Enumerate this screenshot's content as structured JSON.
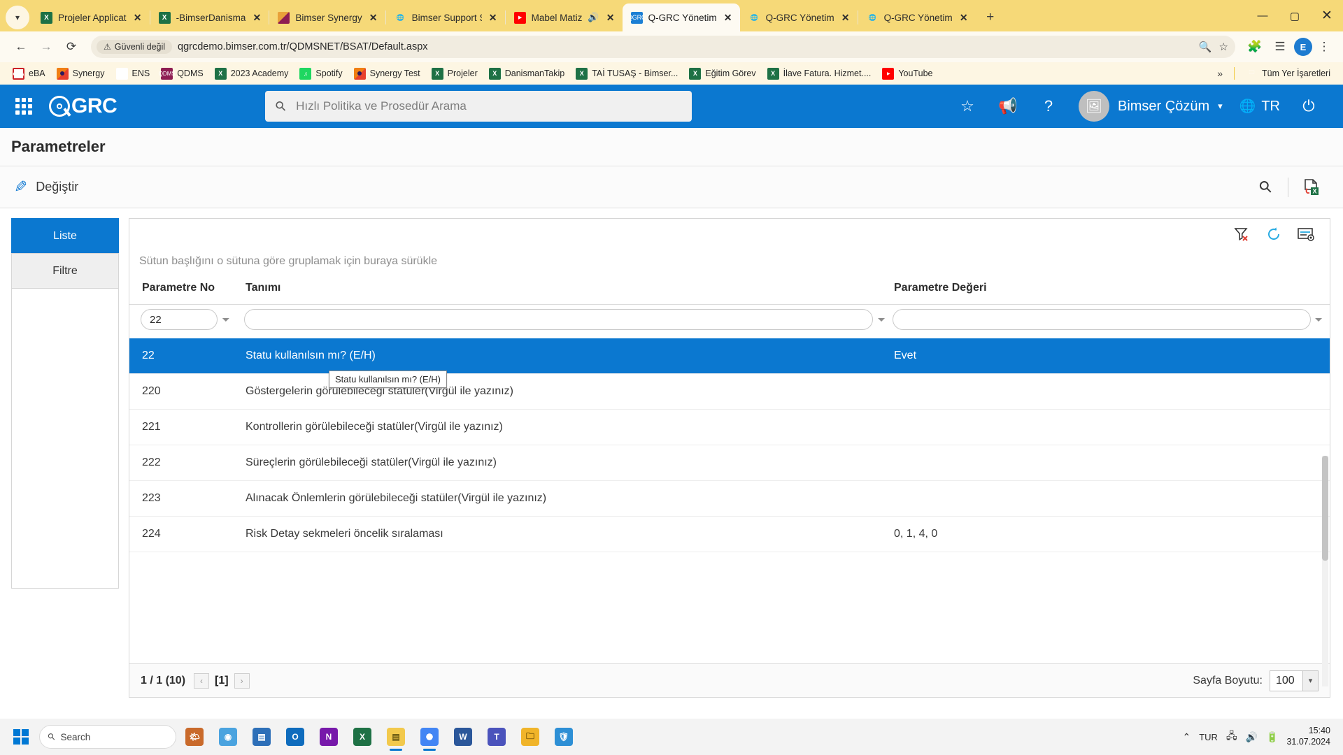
{
  "browser": {
    "tabs": [
      {
        "title": "Projeler Applicat",
        "favicon": "excel-icon",
        "active": false,
        "audio": false
      },
      {
        "title": "-BimserDanisma",
        "favicon": "excel-icon",
        "active": false,
        "audio": false
      },
      {
        "title": "Bimser Synergy",
        "favicon": "bimser-icon",
        "active": false,
        "audio": false
      },
      {
        "title": "Bimser Support S",
        "favicon": "globe-icon",
        "active": false,
        "audio": false
      },
      {
        "title": "Mabel Matiz",
        "favicon": "youtube-icon",
        "active": false,
        "audio": true
      },
      {
        "title": "Q-GRC Yönetim",
        "favicon": "qgrc-icon",
        "active": true,
        "audio": false
      },
      {
        "title": "Q-GRC Yönetim",
        "favicon": "globe-icon",
        "active": false,
        "audio": false
      },
      {
        "title": "Q-GRC Yönetim",
        "favicon": "globe-icon",
        "active": false,
        "audio": false
      }
    ],
    "new_tab_label": "+",
    "window_controls": {
      "minimize": "—",
      "maximize": "▢",
      "close": "✕"
    },
    "nav": {
      "back": "←",
      "forward": "→",
      "reload": "⟳"
    },
    "security_label": "Güvenli değil",
    "security_icon": "warning-triangle-icon",
    "url": "qgrcdemo.bimser.com.tr/QDMSNET/BSAT/Default.aspx",
    "omnibox_icons": {
      "zoom": "zoom-icon",
      "bookmark": "star-icon",
      "extensions": "puzzle-icon",
      "reading_list": "reading-list-icon"
    },
    "profile_initial": "E",
    "menu_icon": "kebab-menu-icon",
    "bookmarks": [
      {
        "label": "eBA",
        "icon": "eba-icon"
      },
      {
        "label": "Synergy",
        "icon": "synergy-icon"
      },
      {
        "label": "ENS",
        "icon": "ens-icon"
      },
      {
        "label": "QDMS",
        "icon": "qdms-icon"
      },
      {
        "label": "2023 Academy",
        "icon": "excel-icon"
      },
      {
        "label": "Spotify",
        "icon": "spotify-icon"
      },
      {
        "label": "Synergy Test",
        "icon": "synergy-icon"
      },
      {
        "label": "Projeler",
        "icon": "excel-icon"
      },
      {
        "label": "DanismanTakip",
        "icon": "excel-icon"
      },
      {
        "label": "TAİ TUSAŞ - Bimser...",
        "icon": "excel-icon"
      },
      {
        "label": "Eğitim Görev",
        "icon": "excel-icon"
      },
      {
        "label": "İlave Fatura. Hizmet....",
        "icon": "excel-icon"
      },
      {
        "label": "YouTube",
        "icon": "youtube-icon"
      }
    ],
    "bookmarks_overflow": "»",
    "all_bookmarks_label": "Tüm Yer İşaretleri",
    "all_bookmarks_icon": "folder-icon"
  },
  "app": {
    "brand": "GRC",
    "apps_grid_icon": "app-grid-icon",
    "search_placeholder": "Hızlı Politika ve Prosedür Arama",
    "search_icon": "search-icon",
    "header_icons": {
      "favorites": "star-icon",
      "announcements": "megaphone-icon",
      "help": "question-mark-icon",
      "power": "power-icon"
    },
    "user_name": "Bimser Çözüm",
    "user_avatar_icon": "avatar-image-icon",
    "user_chevron": "chevron-down-icon",
    "language": "TR",
    "language_icon": "translate-icon",
    "page_title": "Parametreler",
    "action_bar": {
      "edit_label": "Değiştir",
      "edit_icon": "pencil-icon",
      "search_icon": "search-icon",
      "export_excel_icon": "export-excel-icon"
    },
    "side_tabs": [
      {
        "label": "Liste",
        "active": true
      },
      {
        "label": "Filtre",
        "active": false
      }
    ],
    "grid": {
      "tools": {
        "clear_filter_icon": "filter-clear-icon",
        "refresh_icon": "refresh-icon",
        "column_chooser_icon": "column-settings-icon"
      },
      "group_hint": "Sütun başlığını o sütuna göre gruplamak için buraya sürükle",
      "columns": [
        "Parametre No",
        "Tanımı",
        "Parametre Değeri"
      ],
      "filters": {
        "parametre_no": "22",
        "tanimi": "",
        "parametre_degeri": ""
      },
      "filter_icon": "filter-funnel-icon",
      "rows": [
        {
          "no": "22",
          "tanim": "Statu kullanılsın mı? (E/H)",
          "deger": "Evet",
          "selected": true
        },
        {
          "no": "220",
          "tanim": "Göstergelerin görülebileceği statüler(Virgül ile yazınız)",
          "deger": "",
          "selected": false
        },
        {
          "no": "221",
          "tanim": "Kontrollerin görülebileceği statüler(Virgül ile yazınız)",
          "deger": "",
          "selected": false
        },
        {
          "no": "222",
          "tanim": "Süreçlerin görülebileceği statüler(Virgül ile yazınız)",
          "deger": "",
          "selected": false
        },
        {
          "no": "223",
          "tanim": "Alınacak Önlemlerin görülebileceği statüler(Virgül ile yazınız)",
          "deger": "",
          "selected": false
        },
        {
          "no": "224",
          "tanim": "Risk Detay sekmeleri öncelik sıralaması",
          "deger": "0, 1, 4, 0",
          "selected": false
        }
      ],
      "tooltip": "Statu kullanılsın mı? (E/H)",
      "footer": {
        "page_info": "1 / 1 (10)",
        "prev": "‹",
        "current_page": "[1]",
        "next": "›",
        "page_size_label": "Sayfa Boyutu:",
        "page_size_value": "100",
        "page_size_arrow": "chevron-down-icon"
      }
    }
  },
  "taskbar": {
    "start_icon": "windows-start-icon",
    "search_placeholder": "Search",
    "search_icon": "search-icon",
    "apps": [
      "widgets-icon",
      "chrome-old-icon",
      "teams-chat-icon",
      "taskview-icon",
      "outlook-icon",
      "onenote-icon",
      "excel-icon",
      "sticky-notes-icon",
      "chrome-icon",
      "word-icon",
      "teams-icon",
      "file-explorer-icon",
      "security-icon"
    ],
    "tray": {
      "chevron": "show-hidden-icons",
      "language": "TUR",
      "network": "network-icon",
      "volume": "volume-icon",
      "battery": "battery-icon"
    },
    "time": "15:40",
    "date": "31.07.2024"
  },
  "colors": {
    "chrome_theme": "#f6d978",
    "app_blue": "#0b78d0",
    "selected_row": "#0b78d0"
  }
}
